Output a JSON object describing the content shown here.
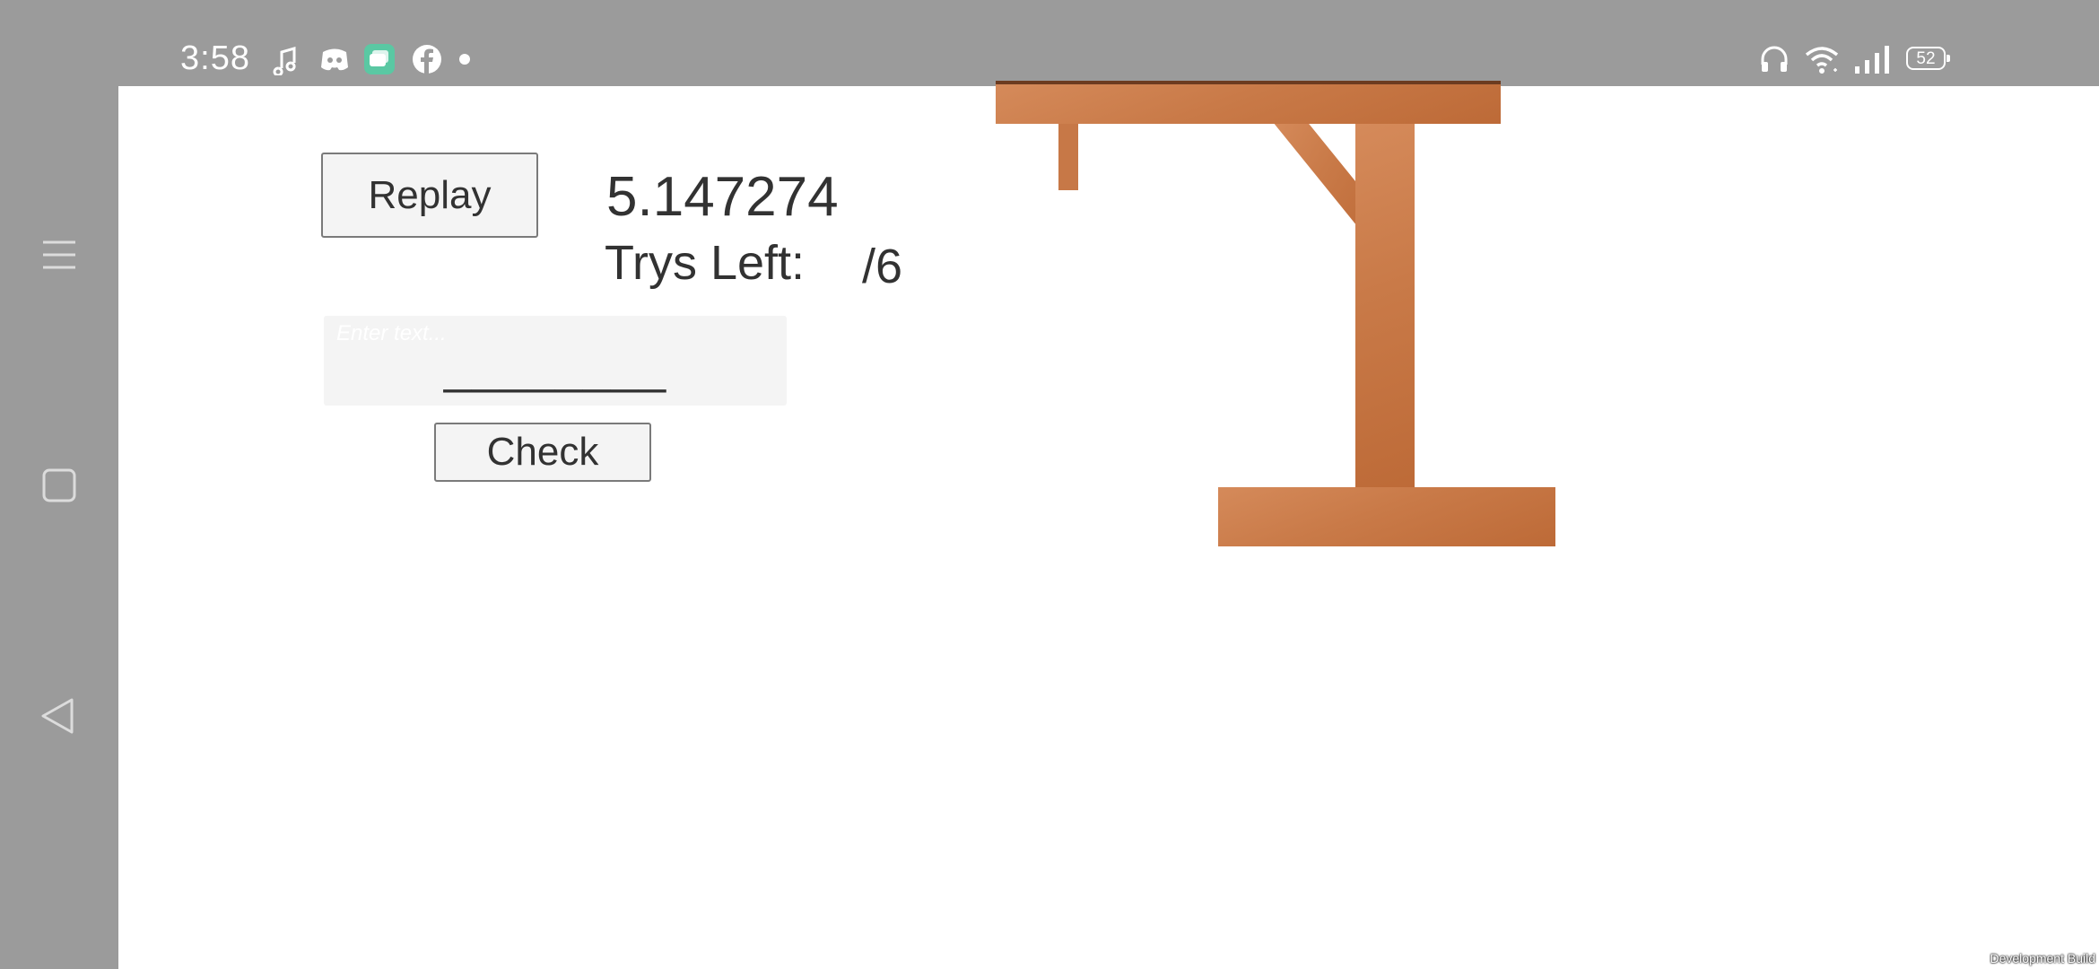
{
  "status_bar": {
    "time": "3:58",
    "battery": "52",
    "left_icons": [
      "music-notification-icon",
      "discord-icon",
      "chat-app-icon",
      "facebook-icon",
      "more-dot-icon"
    ],
    "right_icons": [
      "headphones-icon",
      "wifi-icon",
      "signal-icon",
      "battery-icon"
    ]
  },
  "nav_bar": {
    "buttons": [
      "menu-icon",
      "home-square-icon",
      "back-triangle-icon"
    ]
  },
  "game": {
    "replay_label": "Replay",
    "timer": "5.147274",
    "trys_label": "Trys Left:",
    "trys_value": "/6",
    "input_placeholder": "Enter text...",
    "word_blanks": "________",
    "check_label": "Check",
    "footer_note": "Development Build",
    "colors": {
      "wood": "#c97a48",
      "wood_dark": "#6c3b20",
      "text": "#323232",
      "button_bg": "#f4f4f4"
    }
  }
}
